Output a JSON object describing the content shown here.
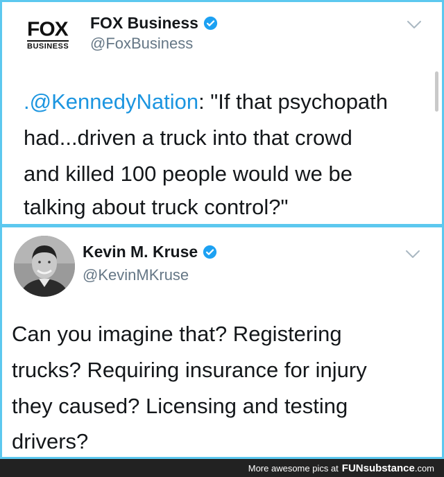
{
  "tweet1": {
    "logo_top": "FOX",
    "logo_bottom": "BUSINESS",
    "name": "FOX Business",
    "handle": "@FoxBusiness",
    "mention": ".@KennedyNation",
    "lines": [
      ": \"If that psychopath",
      "had...driven a truck into that crowd",
      "and killed 100 people would we be",
      "talking about truck control?\""
    ]
  },
  "tweet2": {
    "name": "Kevin M. Kruse",
    "handle": "@KevinMKruse",
    "lines": [
      "Can you imagine that? Registering",
      "trucks? Requiring insurance for injury",
      "they caused? Licensing and testing",
      "drivers?"
    ]
  },
  "footer": {
    "prefix": "More awesome pics at",
    "brand": "FUNsubstance",
    "suffix": ".com"
  },
  "icons": {
    "verified": "verified-badge-icon",
    "chevron": "chevron-down-icon"
  },
  "colors": {
    "border": "#5cc8ef",
    "mention": "#1b95e0",
    "verified": "#1da1f2",
    "footer_bg": "#222222"
  }
}
